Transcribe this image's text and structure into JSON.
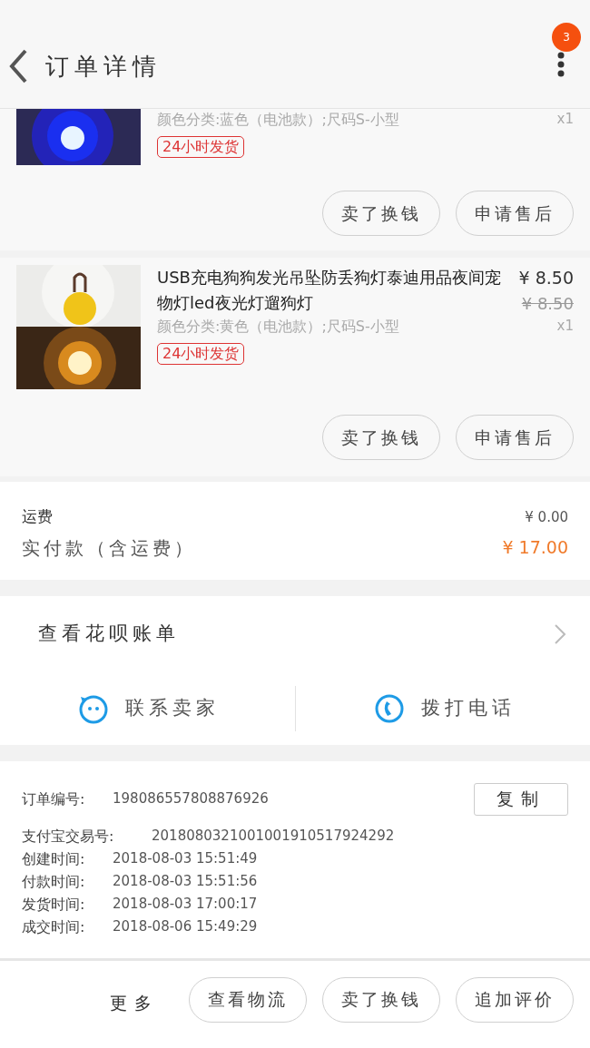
{
  "header": {
    "title": "订单详情",
    "badge": "3"
  },
  "items": [
    {
      "partial": true,
      "spec": "颜色分类:蓝色（电池款）;尺码S-小型",
      "qty": "x1",
      "tag": "24小时发货",
      "buttons": [
        "卖了换钱",
        "申请售后"
      ]
    },
    {
      "partial": false,
      "title": "USB充电狗狗发光吊坠防丢狗灯泰迪用品夜间宠物灯led夜光灯遛狗灯",
      "price": "¥ 8.50",
      "original_price": "¥ 8.50",
      "spec": "颜色分类:黄色（电池款）;尺码S-小型",
      "qty": "x1",
      "tag": "24小时发货",
      "buttons": [
        "卖了换钱",
        "申请售后"
      ]
    }
  ],
  "fees": [
    {
      "label": "运费",
      "value": "¥ 0.00",
      "kind": "plain"
    },
    {
      "label": "实付款（含运费）",
      "value": "¥ 17.00",
      "kind": "total"
    }
  ],
  "huabei": {
    "label": "查看花呗账单"
  },
  "contacts": [
    {
      "label": "联系卖家",
      "kind": "chat"
    },
    {
      "label": "拨打电话",
      "kind": "phone"
    }
  ],
  "order_info": {
    "copy_button": "复制",
    "rows": [
      {
        "label": "订单编号:",
        "value": "198086557808876926"
      },
      {
        "label": "支付宝交易号:",
        "value": "2018080321001001910517924292"
      },
      {
        "label": "创建时间:",
        "value": "2018-08-03 15:51:49"
      },
      {
        "label": "付款时间:",
        "value": "2018-08-03 15:51:56"
      },
      {
        "label": "发货时间:",
        "value": "2018-08-03 17:00:17"
      },
      {
        "label": "成交时间:",
        "value": "2018-08-06 15:49:29"
      }
    ]
  },
  "bottom_bar": {
    "more": "更多",
    "buttons": [
      "查看物流",
      "卖了换钱",
      "追加评价"
    ]
  }
}
